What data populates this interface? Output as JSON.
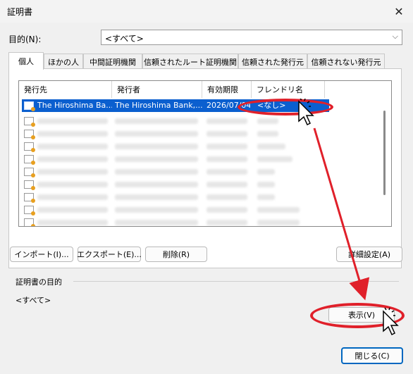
{
  "window": {
    "title": "証明書",
    "close_glyph": "✕"
  },
  "purpose": {
    "label": "目的(N):",
    "value": "<すべて>"
  },
  "tabs": [
    {
      "label": "個人",
      "active": true
    },
    {
      "label": "ほかの人"
    },
    {
      "label": "中間証明機関"
    },
    {
      "label": "信頼されたルート証明機関"
    },
    {
      "label": "信頼された発行元"
    },
    {
      "label": "信頼されない発行元"
    }
  ],
  "list": {
    "columns": [
      "発行先",
      "発行者",
      "有効期限",
      "フレンドリ名"
    ],
    "selected_row": {
      "issued_to": "The Hiroshima Ba...",
      "issued_by": "The Hiroshima Bank,...",
      "expiry": "2026/07/04",
      "friendly_name": "<なし>"
    }
  },
  "buttons": {
    "import": "インポート(I)...",
    "export": "エクスポート(E)...",
    "remove": "削除(R)",
    "advanced": "詳細設定(A)",
    "view": "表示(V)",
    "close": "閉じる(C)"
  },
  "purpose_group": {
    "label": "証明書の目的",
    "value": "<すべて>"
  },
  "annotation": {
    "color": "#e0202a"
  },
  "colors": {
    "selection": "#0b5fcf",
    "accent": "#0067c0"
  }
}
